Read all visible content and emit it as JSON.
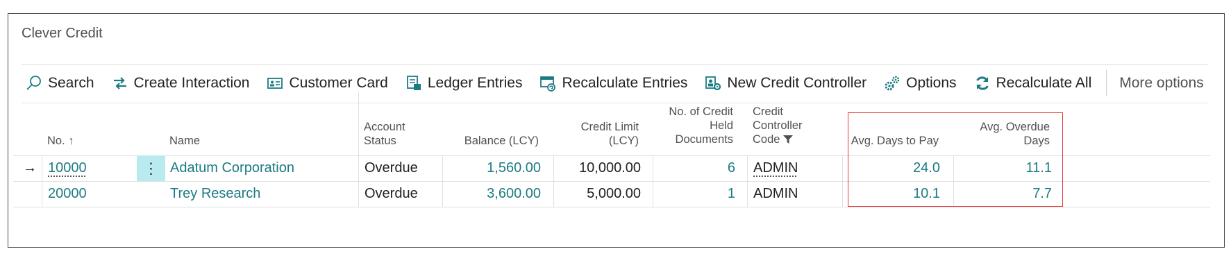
{
  "window": {
    "title": "Clever Credit"
  },
  "toolbar": {
    "search_label": "Search",
    "create_interaction_label": "Create Interaction",
    "customer_card_label": "Customer Card",
    "ledger_entries_label": "Ledger Entries",
    "recalculate_entries_label": "Recalculate Entries",
    "new_credit_controller_label": "New Credit Controller",
    "options_label": "Options",
    "recalculate_all_label": "Recalculate All",
    "more_options_label": "More options"
  },
  "table": {
    "headers": {
      "no_label": "No.",
      "no_sort": "↑",
      "name": "Name",
      "account_status": "Account Status",
      "balance": "Balance (LCY)",
      "credit_limit": "Credit Limit (LCY)",
      "credit_held_docs": "No. of Credit Held Documents",
      "credit_controller_code": "Credit Controller Code",
      "avg_days_to_pay": "Avg. Days to Pay",
      "avg_overdue_days": "Avg. Overdue Days"
    },
    "rows": [
      {
        "no": "10000",
        "name": "Adatum Corporation",
        "account_status": "Overdue",
        "balance": "1,560.00",
        "credit_limit": "10,000.00",
        "credit_held_docs": "6",
        "credit_controller_code": "ADMIN",
        "avg_days_to_pay": "24.0",
        "avg_overdue_days": "11.1"
      },
      {
        "no": "20000",
        "name": "Trey Research",
        "account_status": "Overdue",
        "balance": "3,600.00",
        "credit_limit": "5,000.00",
        "credit_held_docs": "1",
        "credit_controller_code": "ADMIN",
        "avg_days_to_pay": "10.1",
        "avg_overdue_days": "7.7"
      }
    ]
  },
  "colors": {
    "link": "#1b7b83",
    "icon": "#1b7b83",
    "selected_cell": "#b9eaef",
    "highlight_border": "#e53935"
  }
}
